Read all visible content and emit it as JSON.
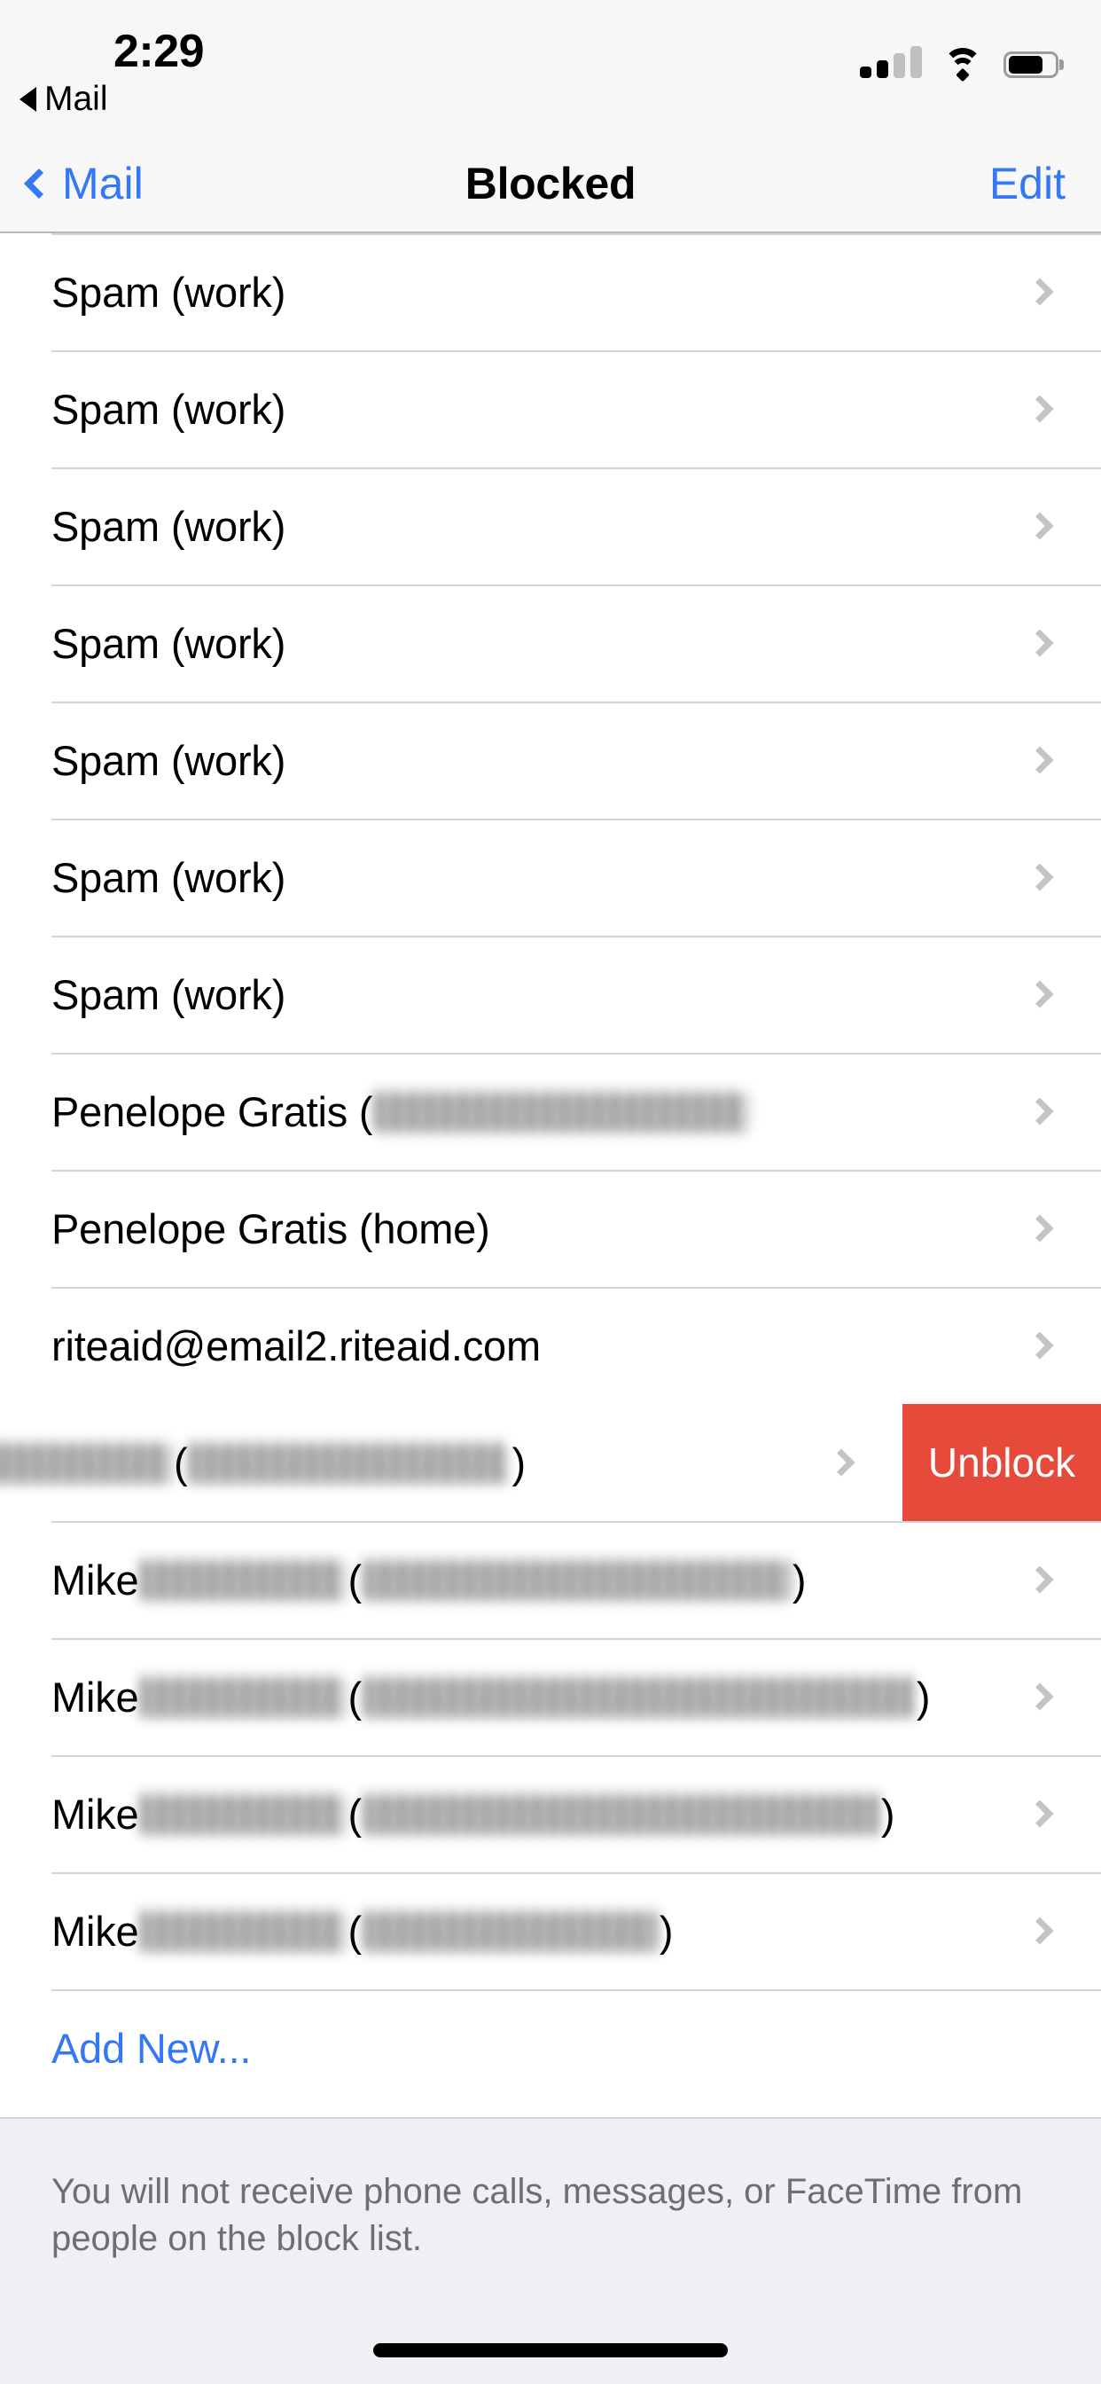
{
  "status_bar": {
    "time": "2:29",
    "back_app_label": "Mail",
    "back_triangle_icon": "back-triangle-icon",
    "cellular_icon": "cellular-signal-icon",
    "cellular_bars_filled": 2,
    "cellular_bars_total": 4,
    "wifi_icon": "wifi-icon",
    "battery_icon": "battery-icon",
    "battery_level_percent": 75
  },
  "nav_bar": {
    "back_label": "Mail",
    "back_chevron_icon": "chevron-left-icon",
    "title": "Blocked",
    "edit_label": "Edit",
    "accent_color": "#3478F6"
  },
  "list": {
    "rows": [
      {
        "id": "row-1",
        "label": "Spam (work)",
        "redacted": false,
        "swiped": false
      },
      {
        "id": "row-2",
        "label": "Spam (work)",
        "redacted": false,
        "swiped": false
      },
      {
        "id": "row-3",
        "label": "Spam (work)",
        "redacted": false,
        "swiped": false
      },
      {
        "id": "row-4",
        "label": "Spam (work)",
        "redacted": false,
        "swiped": false
      },
      {
        "id": "row-5",
        "label": "Spam (work)",
        "redacted": false,
        "swiped": false
      },
      {
        "id": "row-6",
        "label": "Spam (work)",
        "redacted": false,
        "swiped": false
      },
      {
        "id": "row-7",
        "label": "Spam (work)",
        "redacted": false,
        "swiped": false
      },
      {
        "id": "row-8",
        "label": "Penelope Gratis (",
        "redacted": true,
        "redacted_width": 420,
        "swiped": false
      },
      {
        "id": "row-9",
        "label": "Penelope Gratis (home)",
        "redacted": false,
        "swiped": false
      },
      {
        "id": "row-10",
        "label": "riteaid@email2.riteaid.com",
        "redacted": false,
        "swiped": false
      },
      {
        "id": "row-11",
        "label": "",
        "redacted": true,
        "swiped": true
      },
      {
        "id": "row-12",
        "label": "Mike",
        "redacted": true,
        "swiped": false
      },
      {
        "id": "row-13",
        "label": "Mike",
        "redacted": true,
        "swiped": false
      },
      {
        "id": "row-14",
        "label": "Mike",
        "redacted": true,
        "swiped": false
      },
      {
        "id": "row-15",
        "label": "Mike",
        "redacted": true,
        "swiped": false
      }
    ],
    "chevron_icon": "chevron-right-icon",
    "add_new_label": "Add New...",
    "unblock_label": "Unblock",
    "unblock_color": "#E64A3B"
  },
  "footer": {
    "text": "You will not receive phone calls, messages, or FaceTime from people on the block list."
  },
  "home_indicator": {
    "icon": "home-indicator-bar"
  }
}
